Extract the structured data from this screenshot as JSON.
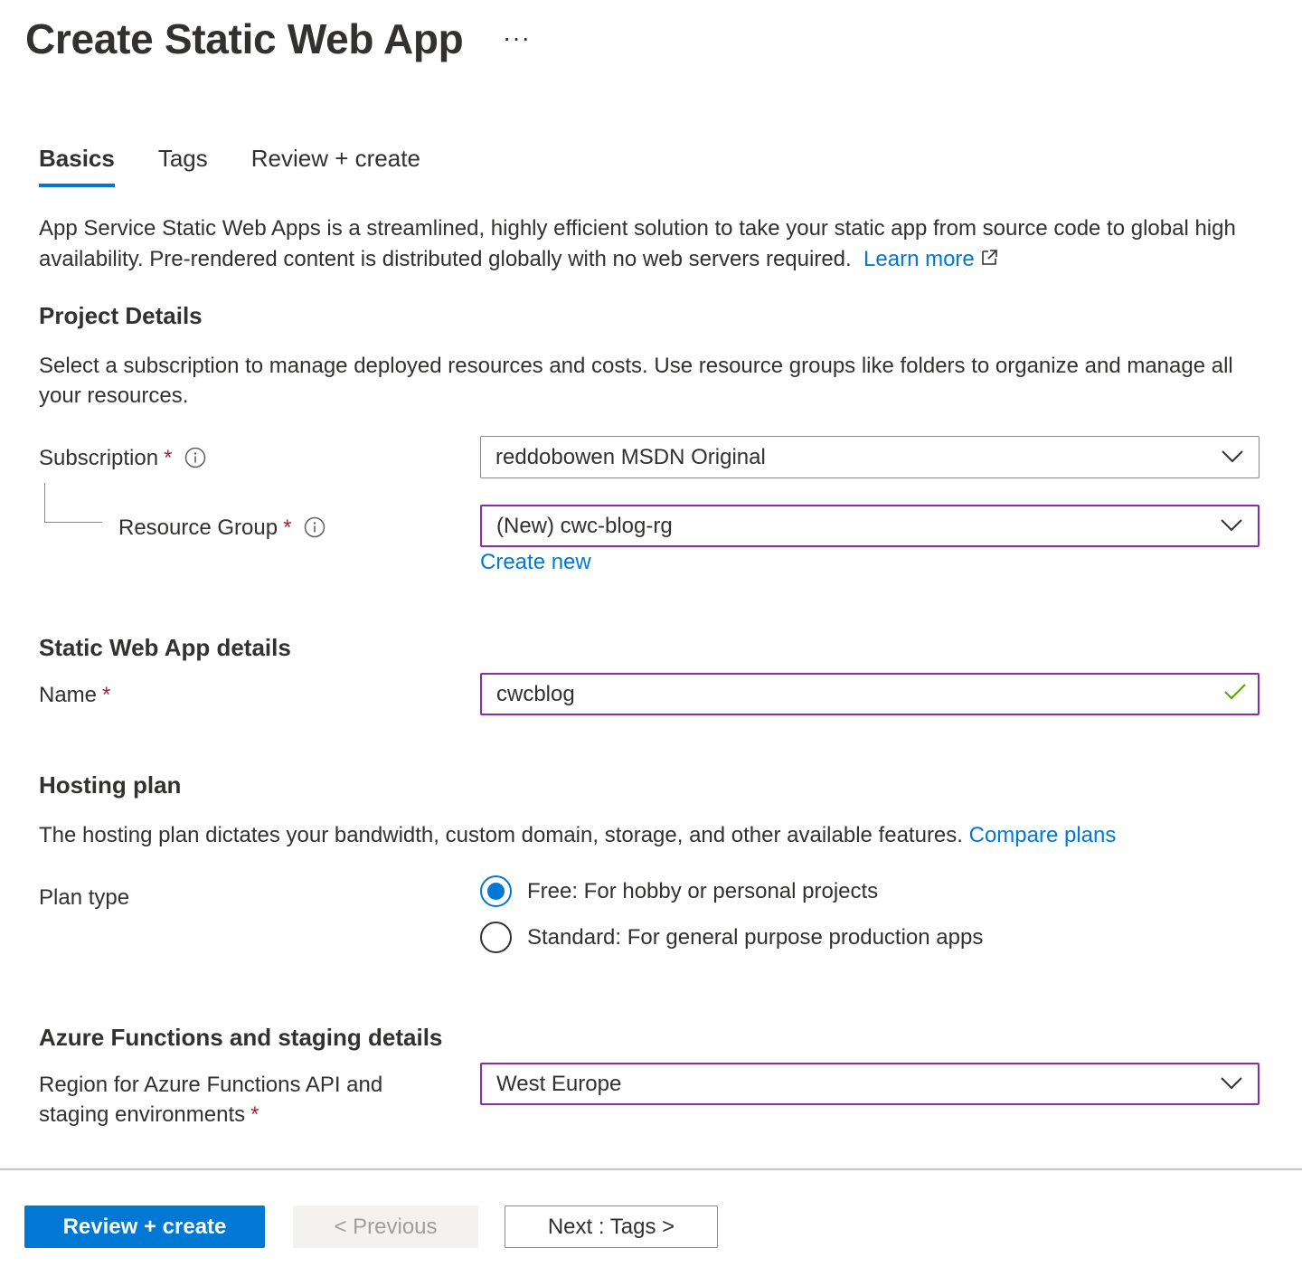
{
  "header": {
    "title": "Create Static Web App",
    "more_label": "···"
  },
  "tabs": [
    {
      "label": "Basics",
      "active": true
    },
    {
      "label": "Tags",
      "active": false
    },
    {
      "label": "Review + create",
      "active": false
    }
  ],
  "intro": {
    "text": "App Service Static Web Apps is a streamlined, highly efficient solution to take your static app from source code to global high availability. Pre-rendered content is distributed globally with no web servers required.",
    "learn_more": "Learn more"
  },
  "project_details": {
    "heading": "Project Details",
    "description": "Select a subscription to manage deployed resources and costs. Use resource groups like folders to organize and manage all your resources.",
    "subscription_label": "Subscription",
    "subscription_value": "reddobowen MSDN Original",
    "resource_group_label": "Resource Group",
    "resource_group_value": "(New) cwc-blog-rg",
    "create_new": "Create new",
    "required_mark": "*"
  },
  "static_web_app_details": {
    "heading": "Static Web App details",
    "name_label": "Name",
    "name_value": "cwcblog"
  },
  "hosting_plan": {
    "heading": "Hosting plan",
    "description": "The hosting plan dictates your bandwidth, custom domain, storage, and other available features.",
    "compare_plans": "Compare plans",
    "plan_type_label": "Plan type",
    "options": [
      {
        "label": "Free: For hobby or personal projects",
        "checked": true
      },
      {
        "label": "Standard: For general purpose production apps",
        "checked": false
      }
    ]
  },
  "azure_functions": {
    "heading": "Azure Functions and staging details",
    "region_label_line1": "Region for Azure Functions API and",
    "region_label_line2": "staging environments",
    "region_value": "West Europe"
  },
  "footer": {
    "review_create": "Review + create",
    "previous": "< Previous",
    "next": "Next : Tags >"
  },
  "colors": {
    "accent": "#0078d4",
    "focus_border": "#8a2da5",
    "required": "#a4262c",
    "valid_check": "#57a300"
  },
  "icons": {
    "info": "info-icon",
    "chevron": "chevron-down-icon",
    "external": "external-link-icon",
    "check": "checkmark-icon"
  }
}
